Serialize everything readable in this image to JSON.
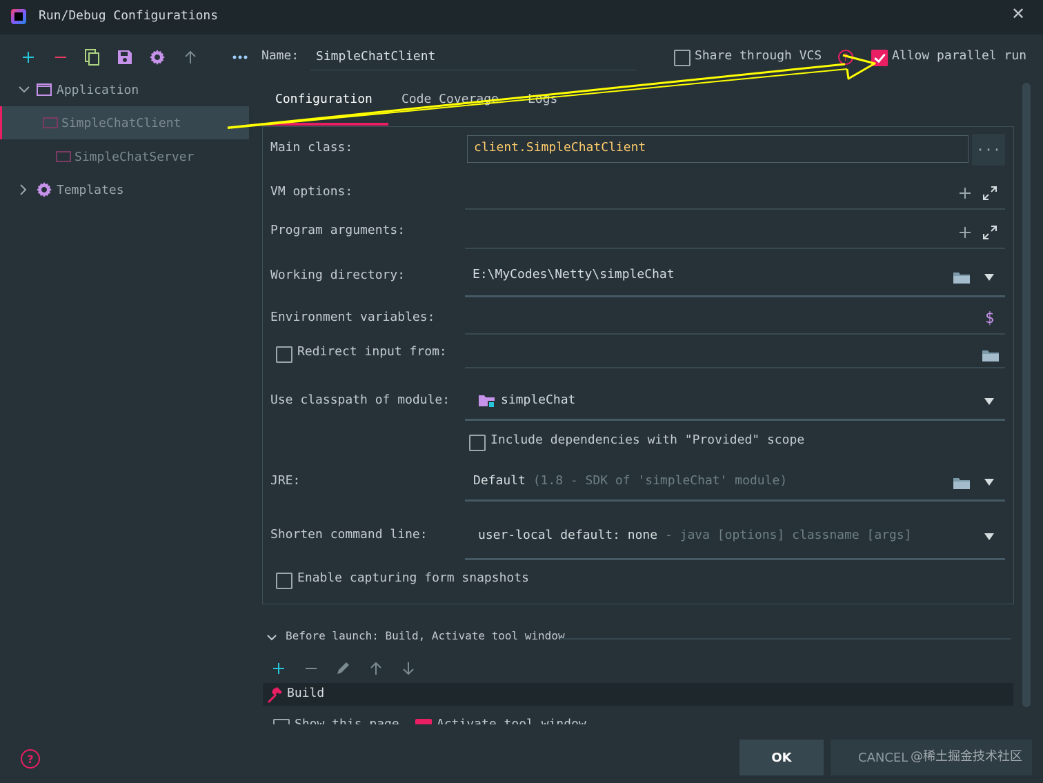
{
  "window": {
    "title": "Run/Debug Configurations"
  },
  "colors": {
    "accent": "#e91e63",
    "background": "#263238",
    "annotation": "#ffff00",
    "icon_purple": "#c792ea",
    "icon_teal": "#26c6da"
  },
  "toolbar": {
    "icons": [
      "add-icon",
      "remove-icon",
      "copy-icon",
      "save-icon",
      "gear-icon",
      "move-up-icon",
      "more-icon"
    ]
  },
  "tree": {
    "group": "Application",
    "items": [
      "SimpleChatClient",
      "SimpleChatServer"
    ],
    "templates": "Templates"
  },
  "header": {
    "name_label": "Name:",
    "name_value": "SimpleChatClient",
    "share_label": "Share through VCS",
    "parallel_label": "Allow parallel run"
  },
  "tabs": [
    "Configuration",
    "Code Coverage",
    "Logs"
  ],
  "form": {
    "main_class_label": "Main class:",
    "main_class_value": "client.SimpleChatClient",
    "vm_options_label": "VM options:",
    "program_args_label": "Program arguments:",
    "working_dir_label": "Working directory:",
    "working_dir_value": "E:\\MyCodes\\Netty\\simpleChat",
    "env_vars_label": "Environment variables:",
    "redirect_label": "Redirect input from:",
    "classpath_label": "Use classpath of module:",
    "classpath_value": "simpleChat",
    "include_deps_label": "Include dependencies with \"Provided\" scope",
    "jre_label": "JRE:",
    "jre_value": "Default",
    "jre_hint": "(1.8 - SDK of 'simpleChat' module)",
    "shorten_label": "Shorten command line:",
    "shorten_value": "user-local default: none",
    "shorten_hint": "- java [options] classname [args]",
    "snapshots_label": "Enable capturing form snapshots"
  },
  "before_launch": {
    "title": "Before launch: Build, Activate tool window",
    "item": "Build",
    "show_page": "Show this page",
    "activate": "Activate tool window"
  },
  "footer": {
    "ok": "OK",
    "cancel": "CANCEL",
    "watermark": "@稀土掘金技术社区"
  }
}
